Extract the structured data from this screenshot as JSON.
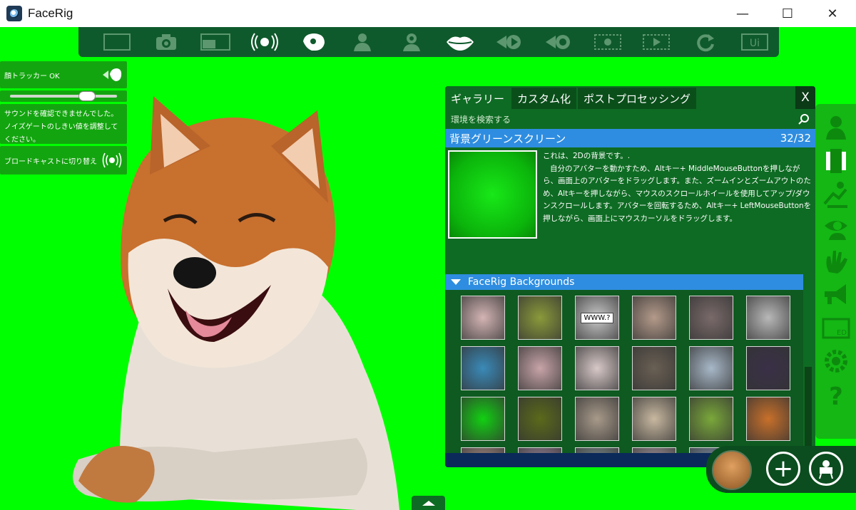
{
  "window": {
    "title": "FaceRig",
    "minimize": "—",
    "maximize": "☐",
    "close": "✕"
  },
  "toolbar": {
    "buttons": [
      {
        "name": "fullscreen-icon"
      },
      {
        "name": "camera-icon"
      },
      {
        "name": "picture-in-picture-icon"
      },
      {
        "name": "broadcast-icon"
      },
      {
        "name": "head-profile-icon"
      },
      {
        "name": "avatar-icon"
      },
      {
        "name": "avatar-gear-icon"
      },
      {
        "name": "lips-icon"
      },
      {
        "name": "rewind-play-icon"
      },
      {
        "name": "record-icon"
      },
      {
        "name": "film-record-icon"
      },
      {
        "name": "film-play-icon"
      },
      {
        "name": "refresh-icon"
      },
      {
        "name": "ui-toggle-icon"
      }
    ]
  },
  "left_panel": {
    "tracker_label": "顔トラッカー OK",
    "sound_warning": "サウンドを確認できませんでした。ノイズゲートのしきい値を調整してください。",
    "broadcast_label": "ブロードキャストに切り替え"
  },
  "gallery": {
    "tabs": [
      "ギャラリー",
      "カスタム化",
      "ポストプロセッシング"
    ],
    "close_label": "X",
    "search_placeholder": "環境を検索する",
    "selected_name": "背景グリーンスクリーン",
    "selected_count": "32/32",
    "description": "これは、2Dの背景です。.\n   自分のアバターを動かすため、Altキー+ MiddleMouseButtonを押しながら、画面上のアバターをドラッグします。また、ズームインとズームアウトのため、Altキーを押しながら、マウスのスクロールホイールを使用してアップ/ダウンスクロールします。アバターを回転するため、Altキー+ LeftMouseButtonを押しながら、画面上にマウスカーソルをドラッグします。",
    "section_title": "FaceRig Backgrounds",
    "thumbnails": [
      {
        "label": "",
        "color": "#d4b4b4"
      },
      {
        "label": "",
        "color": "#8a9a3a"
      },
      {
        "label": "WWW.?",
        "color": "#c8c8c8"
      },
      {
        "label": "",
        "color": "#b49a8a"
      },
      {
        "label": "",
        "color": "#7a6a6a"
      },
      {
        "label": "",
        "color": "#b8b8b8"
      },
      {
        "label": "",
        "color": "#3a8ab8"
      },
      {
        "label": "",
        "color": "#c8a4a8"
      },
      {
        "label": "",
        "color": "#d8c8c8"
      },
      {
        "label": "",
        "color": "#6a6054"
      },
      {
        "label": "",
        "color": "#a8b8c8"
      },
      {
        "label": "",
        "color": "#3a3048"
      },
      {
        "label": "",
        "color": "#12d012"
      },
      {
        "label": "",
        "color": "#5a6a1a"
      },
      {
        "label": "",
        "color": "#a89a8a"
      },
      {
        "label": "",
        "color": "#c8b8a0"
      },
      {
        "label": "",
        "color": "#7aa83a"
      },
      {
        "label": "",
        "color": "#c8702a"
      },
      {
        "label": "",
        "color": "#b89a90"
      },
      {
        "label": "",
        "color": "#a890a8"
      },
      {
        "label": "",
        "color": "#8a9a9a"
      },
      {
        "label": "",
        "color": "#b8a8b0"
      },
      {
        "label": "",
        "color": "#8aa0b8"
      },
      {
        "label": "",
        "color": "#b0a890"
      }
    ]
  },
  "sidebar": {
    "icons": [
      "avatar-icon",
      "body-icon",
      "motion-icon",
      "eye-profile-icon",
      "hand-wave-icon",
      "megaphone-icon",
      "ed-panel-icon",
      "settings-gear-icon",
      "help-icon"
    ]
  },
  "bottom": {
    "add_label": "+",
    "collapse_label": "▲"
  }
}
